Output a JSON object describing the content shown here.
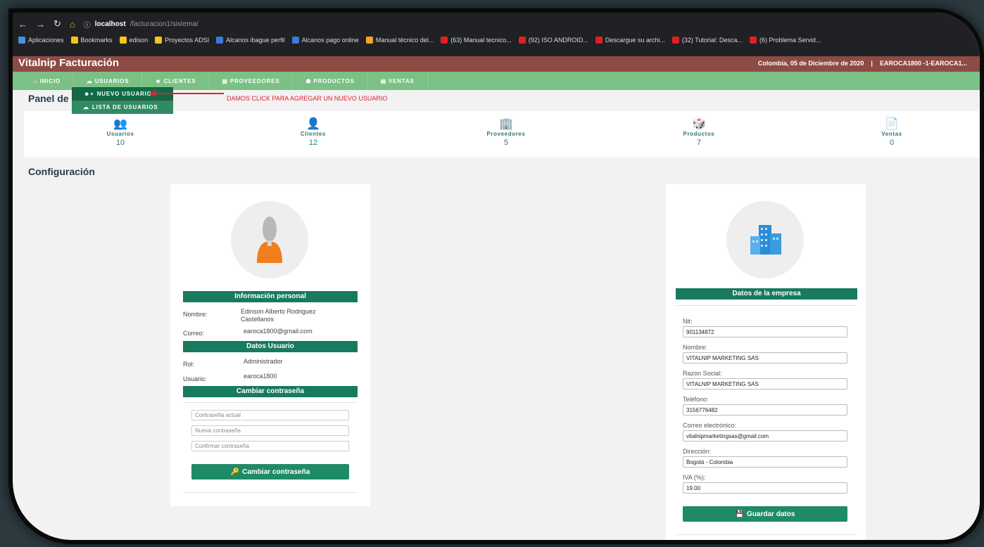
{
  "browser": {
    "url_host": "localhost",
    "url_path": "/facturacion1/sistema/",
    "bookmarks": [
      {
        "label": "Aplicaciones",
        "color": "#4a90e2"
      },
      {
        "label": "Bookmarks",
        "color": "#f5c518"
      },
      {
        "label": "edison",
        "color": "#f5c518"
      },
      {
        "label": "Proyectos ADSI",
        "color": "#f5c518"
      },
      {
        "label": "Alcanos ibague perfil",
        "color": "#3a7bd5"
      },
      {
        "label": "Alcanos pago online",
        "color": "#3a7bd5"
      },
      {
        "label": "Manual técnico del...",
        "color": "#f5a623"
      },
      {
        "label": "(63) Manual tecnico...",
        "color": "#e02020"
      },
      {
        "label": "(92) ISO ANDROID...",
        "color": "#e02020"
      },
      {
        "label": "Descargue su archi...",
        "color": "#e02020"
      },
      {
        "label": "(32) Tutorial: Desca...",
        "color": "#e02020"
      },
      {
        "label": "(6) Problema Servid...",
        "color": "#e02020"
      }
    ]
  },
  "header": {
    "brand": "Vitalnip Facturación",
    "date": "Colombia, 05 de Diciembre de 2020",
    "separator": "|",
    "user": "EAROCA1800 -1-EAROCA1..."
  },
  "nav": {
    "items": [
      {
        "icon": "⌂",
        "label": "Inicio"
      },
      {
        "icon": "☁",
        "label": "Usuarios"
      },
      {
        "icon": "☻",
        "label": "Clientes"
      },
      {
        "icon": "▤",
        "label": "Proveedores"
      },
      {
        "icon": "☗",
        "label": "Productos"
      },
      {
        "icon": "▤",
        "label": "Ventas"
      }
    ],
    "dropdown": [
      {
        "icon": "☻+",
        "label": "NUEVO USUARIO"
      },
      {
        "icon": "☁",
        "label": "LISTA DE USUARIOS"
      }
    ]
  },
  "annotation": {
    "text": "DAMOS CLICK PARA AGREGAR UN NUEVO USUARIO"
  },
  "panel": {
    "title": "Panel de"
  },
  "stats": [
    {
      "icon": "👥",
      "label": "Usuarios",
      "value": "10"
    },
    {
      "icon": "👤",
      "label": "Clientes",
      "value": "12"
    },
    {
      "icon": "🏢",
      "label": "Proveedores",
      "value": "5"
    },
    {
      "icon": "🎲",
      "label": "Productos",
      "value": "7"
    },
    {
      "icon": "📄",
      "label": "Ventas",
      "value": "0"
    }
  ],
  "config": {
    "title": "Configuración"
  },
  "user_card": {
    "section_personal": "Información personal",
    "nombre_label": "Nombre:",
    "nombre_value": "Edinson Alberto Rodriguez Castellanos",
    "correo_label": "Correo:",
    "correo_value": "earoca1800@gmail.com",
    "section_usuario": "Datos Usuario",
    "rol_label": "Rol:",
    "rol_value": "Administrador",
    "usuario_label": "Usuario:",
    "usuario_value": "earoca1800",
    "section_password": "Cambiar contraseña",
    "pw_current_placeholder": "Contraseña actual",
    "pw_new_placeholder": "Nueva contraseña",
    "pw_confirm_placeholder": "Confirmar contraseña",
    "change_button": "Cambiar contraseña"
  },
  "company_card": {
    "section_title": "Datos de la empresa",
    "nit_label": "Nit:",
    "nit_value": "901134872",
    "nombre_label": "Nombre:",
    "nombre_value": "VITALNIP MARKETING SAS",
    "razon_label": "Razon Social:",
    "razon_value": "VITALNIP MARKETING SAS",
    "telefono_label": "Teléfono:",
    "telefono_value": "3156776482",
    "correo_label": "Correo electrónico:",
    "correo_value": "vitalnipmarketingsas@gmail.com",
    "direccion_label": "Dirección:",
    "direccion_value": "Bogotá - Colombia",
    "iva_label": "IVA (%):",
    "iva_value": "19.00",
    "save_button": "Guardar datos"
  }
}
